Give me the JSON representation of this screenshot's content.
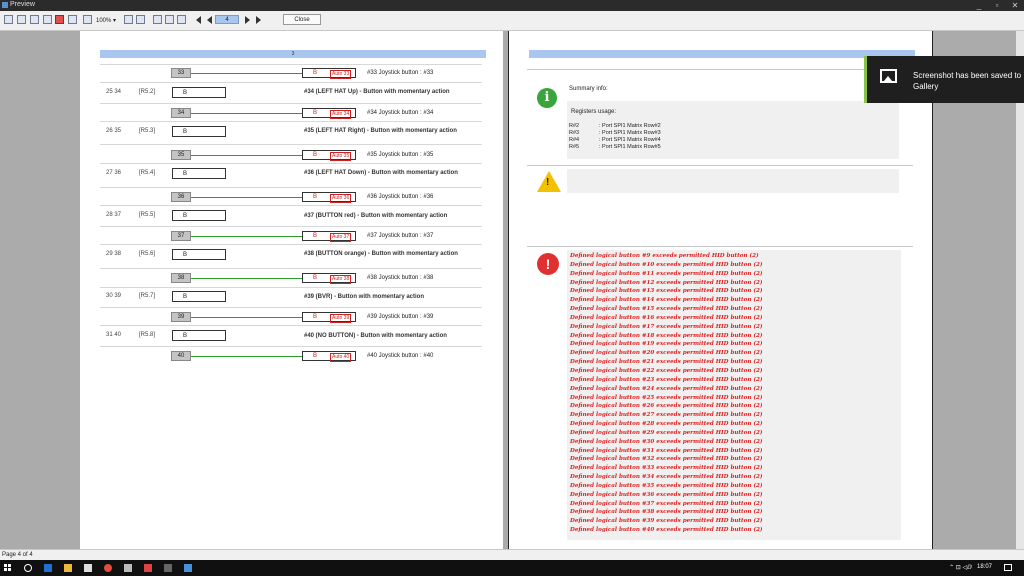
{
  "window": {
    "title": "Preview",
    "min": "_",
    "max": "▫",
    "close": "✕"
  },
  "toolbar": {
    "zoom": "100% ▾",
    "page_input": "4",
    "close_label": "Close"
  },
  "page1": {
    "header_label": "3",
    "mappings": [
      {
        "button": "33",
        "b": "B",
        "auto": "Auto 33",
        "joystick": "#33 Joystick button : #33"
      },
      {
        "button": "34",
        "b": "B",
        "auto": "Auto 34",
        "joystick": "#34 Joystick button : #34"
      },
      {
        "button": "35",
        "b": "B",
        "auto": "Auto 35",
        "joystick": "#35 Joystick button : #35"
      },
      {
        "button": "36",
        "b": "B",
        "auto": "Auto 36",
        "joystick": "#36 Joystick button : #36"
      },
      {
        "button": "37",
        "b": "B",
        "auto": "Auto 37",
        "joystick": "#37 Joystick button : #37"
      },
      {
        "button": "38",
        "b": "B",
        "auto": "Auto 38",
        "joystick": "#38 Joystick button : #38"
      },
      {
        "button": "39",
        "b": "B",
        "auto": "Auto 39",
        "joystick": "#39 Joystick button : #39"
      },
      {
        "button": "40",
        "b": "B",
        "auto": "Auto 40",
        "joystick": "#40 Joystick button : #40"
      }
    ],
    "inputs": [
      {
        "num": "25 34",
        "rs": "[R5.2]",
        "input": "B",
        "desc": "#34 (LEFT HAT Up) - Button with momentary action"
      },
      {
        "num": "26 35",
        "rs": "[R5.3]",
        "input": "B",
        "desc": "#35 (LEFT HAT Right) - Button with momentary action"
      },
      {
        "num": "27 36",
        "rs": "[R5.4]",
        "input": "B",
        "desc": "#36 (LEFT HAT Down) - Button with momentary action"
      },
      {
        "num": "28 37",
        "rs": "[R5.5]",
        "input": "B",
        "desc": "#37 (BUTTON red) - Button with momentary action"
      },
      {
        "num": "29 38",
        "rs": "[R5.6]",
        "input": "B",
        "desc": "#38 (BUTTON orange) - Button with momentary action"
      },
      {
        "num": "30 39",
        "rs": "[R5.7]",
        "input": "B",
        "desc": "#39 (BVR) - Button with momentary action"
      },
      {
        "num": "31 40",
        "rs": "[R5.8]",
        "input": "B",
        "desc": "#40 (NO BUTTON) - Button with momentary action"
      }
    ]
  },
  "page2": {
    "summary_title": "Summary info:",
    "registers_title": "Registers usage:",
    "registers": [
      {
        "reg": "R#2",
        "desc": ": Port SPI1 Matrix Row#2"
      },
      {
        "reg": "R#3",
        "desc": ": Port SPI1 Matrix Row#3"
      },
      {
        "reg": "R#4",
        "desc": ": Port SPI1 Matrix Row#4"
      },
      {
        "reg": "R#5",
        "desc": ": Port SPI1 Matrix Row#5"
      }
    ],
    "errors": [
      "Defined logical button #9 exceeds permitted HID button (2)",
      "Defined logical button #10 exceeds permitted HID button (2)",
      "Defined logical button #11 exceeds permitted HID button (2)",
      "Defined logical button #12 exceeds permitted HID button (2)",
      "Defined logical button #13 exceeds permitted HID button (2)",
      "Defined logical button #14 exceeds permitted HID button (2)",
      "Defined logical button #15 exceeds permitted HID button (2)",
      "Defined logical button #16 exceeds permitted HID button (2)",
      "Defined logical button #17 exceeds permitted HID button (2)",
      "Defined logical button #18 exceeds permitted HID button (2)",
      "Defined logical button #19 exceeds permitted HID button (2)",
      "Defined logical button #20 exceeds permitted HID button (2)",
      "Defined logical button #21 exceeds permitted HID button (2)",
      "Defined logical button #22 exceeds permitted HID button (2)",
      "Defined logical button #23 exceeds permitted HID button (2)",
      "Defined logical button #24 exceeds permitted HID button (2)",
      "Defined logical button #25 exceeds permitted HID button (2)",
      "Defined logical button #26 exceeds permitted HID button (2)",
      "Defined logical button #27 exceeds permitted HID button (2)",
      "Defined logical button #28 exceeds permitted HID button (2)",
      "Defined logical button #29 exceeds permitted HID button (2)",
      "Defined logical button #30 exceeds permitted HID button (2)",
      "Defined logical button #31 exceeds permitted HID button (2)",
      "Defined logical button #32 exceeds permitted HID button (2)",
      "Defined logical button #33 exceeds permitted HID button (2)",
      "Defined logical button #34 exceeds permitted HID button (2)",
      "Defined logical button #35 exceeds permitted HID button (2)",
      "Defined logical button #36 exceeds permitted HID button (2)",
      "Defined logical button #37 exceeds permitted HID button (2)",
      "Defined logical button #38 exceeds permitted HID button (2)",
      "Defined logical button #39 exceeds permitted HID button (2)",
      "Defined logical button #40 exceeds permitted HID button (2)"
    ]
  },
  "toast": {
    "message": "Screenshot has been saved to Gallery",
    "accent": "#8bc34a"
  },
  "status": {
    "page_text": "Page 4 of 4"
  },
  "taskbar": {
    "clock": "18:07",
    "tray": "⌃ ⊡ ◁ⅅ"
  },
  "colors": {
    "header_blue": "#a9c7ee",
    "line_green": "#2aa02a",
    "error_red": "#e02020"
  }
}
